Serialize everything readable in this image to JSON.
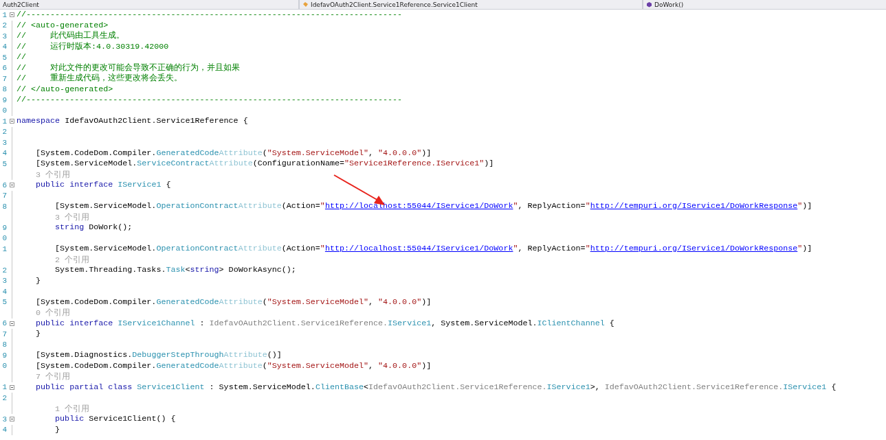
{
  "navigation_bar": [
    {
      "label": "Auth2Client"
    },
    {
      "label": "IdefavOAuth2Client.Service1Reference.Service1Client"
    },
    {
      "label": "DoWork()"
    }
  ],
  "editor": {
    "rows": [
      {
        "kind": "code",
        "gutter": "1",
        "collapsible": true,
        "tokens": [
          {
            "kind": "comment",
            "text": "//------------------------------------------------------------------------------"
          }
        ]
      },
      {
        "kind": "code",
        "gutter": "2",
        "collapsible": false,
        "tokens": [
          {
            "kind": "comment",
            "text": "// <auto-generated>"
          }
        ]
      },
      {
        "kind": "code",
        "gutter": "3",
        "collapsible": false,
        "tokens": [
          {
            "kind": "comment",
            "text": "//     此代码由工具生成。"
          }
        ]
      },
      {
        "kind": "code",
        "gutter": "4",
        "collapsible": false,
        "tokens": [
          {
            "kind": "comment",
            "text": "//     运行时版本:4.0.30319.42000"
          }
        ]
      },
      {
        "kind": "code",
        "gutter": "5",
        "collapsible": false,
        "tokens": [
          {
            "kind": "comment",
            "text": "//"
          }
        ]
      },
      {
        "kind": "code",
        "gutter": "6",
        "collapsible": false,
        "tokens": [
          {
            "kind": "comment",
            "text": "//     对此文件的更改可能会导致不正确的行为，并且如果"
          }
        ]
      },
      {
        "kind": "code",
        "gutter": "7",
        "collapsible": false,
        "tokens": [
          {
            "kind": "comment",
            "text": "//     重新生成代码，这些更改将会丢失。"
          }
        ]
      },
      {
        "kind": "code",
        "gutter": "8",
        "collapsible": false,
        "tokens": [
          {
            "kind": "comment",
            "text": "// </auto-generated>"
          }
        ]
      },
      {
        "kind": "code",
        "gutter": "9",
        "collapsible": false,
        "tokens": [
          {
            "kind": "comment",
            "text": "//------------------------------------------------------------------------------"
          }
        ]
      },
      {
        "kind": "code",
        "gutter": "0",
        "collapsible": false,
        "tokens": []
      },
      {
        "kind": "code",
        "gutter": "1",
        "collapsible": true,
        "tokens": [
          {
            "kind": "keyword",
            "text": "namespace"
          },
          {
            "kind": "plain",
            "text": " IdefavOAuth2Client.Service1Reference {"
          }
        ]
      },
      {
        "kind": "code",
        "gutter": "2",
        "collapsible": false,
        "tokens": []
      },
      {
        "kind": "code",
        "gutter": "3",
        "collapsible": false,
        "tokens": []
      },
      {
        "kind": "code",
        "gutter": "4",
        "collapsible": false,
        "tokens": [
          {
            "kind": "plain",
            "text": "    [System.CodeDom.Compiler."
          },
          {
            "kind": "type",
            "text": "GeneratedCode"
          },
          {
            "kind": "faded",
            "text": "Attribute"
          },
          {
            "kind": "plain",
            "text": "("
          },
          {
            "kind": "string",
            "text": "\"System.ServiceModel\""
          },
          {
            "kind": "plain",
            "text": ", "
          },
          {
            "kind": "string",
            "text": "\"4.0.0.0\""
          },
          {
            "kind": "plain",
            "text": ")]"
          }
        ]
      },
      {
        "kind": "code",
        "gutter": "5",
        "collapsible": false,
        "tokens": [
          {
            "kind": "plain",
            "text": "    [System.ServiceModel."
          },
          {
            "kind": "type",
            "text": "ServiceContract"
          },
          {
            "kind": "faded",
            "text": "Attribute"
          },
          {
            "kind": "plain",
            "text": "(ConfigurationName="
          },
          {
            "kind": "string",
            "text": "\"Service1Reference.IService1\""
          },
          {
            "kind": "plain",
            "text": ")]"
          }
        ]
      },
      {
        "kind": "lens",
        "text": "    3 个引用"
      },
      {
        "kind": "code",
        "gutter": "6",
        "collapsible": true,
        "tokens": [
          {
            "kind": "keyword",
            "text": "    public"
          },
          {
            "kind": "keyword",
            "text": " interface"
          },
          {
            "kind": "type",
            "text": " IService1"
          },
          {
            "kind": "plain",
            "text": " {"
          }
        ]
      },
      {
        "kind": "code",
        "gutter": "7",
        "collapsible": false,
        "tokens": []
      },
      {
        "kind": "code",
        "gutter": "8",
        "collapsible": false,
        "tokens": [
          {
            "kind": "plain",
            "text": "        [System.ServiceModel."
          },
          {
            "kind": "type",
            "text": "OperationContract"
          },
          {
            "kind": "faded",
            "text": "Attribute"
          },
          {
            "kind": "plain",
            "text": "(Action="
          },
          {
            "kind": "string",
            "text": "\""
          },
          {
            "kind": "link",
            "text": "http://localhost:55044/IService1/DoWork"
          },
          {
            "kind": "string",
            "text": "\""
          },
          {
            "kind": "plain",
            "text": ", ReplyAction="
          },
          {
            "kind": "string",
            "text": "\""
          },
          {
            "kind": "link",
            "text": "http://tempuri.org/IService1/DoWorkResponse"
          },
          {
            "kind": "string",
            "text": "\""
          },
          {
            "kind": "plain",
            "text": ")]"
          }
        ]
      },
      {
        "kind": "lens",
        "text": "        3 个引用"
      },
      {
        "kind": "code",
        "gutter": "9",
        "collapsible": false,
        "tokens": [
          {
            "kind": "keyword",
            "text": "        string"
          },
          {
            "kind": "plain",
            "text": " DoWork();"
          }
        ]
      },
      {
        "kind": "code",
        "gutter": "0",
        "collapsible": false,
        "tokens": []
      },
      {
        "kind": "code",
        "gutter": "1",
        "collapsible": false,
        "tokens": [
          {
            "kind": "plain",
            "text": "        [System.ServiceModel."
          },
          {
            "kind": "type",
            "text": "OperationContract"
          },
          {
            "kind": "faded",
            "text": "Attribute"
          },
          {
            "kind": "plain",
            "text": "(Action="
          },
          {
            "kind": "string",
            "text": "\""
          },
          {
            "kind": "link",
            "text": "http://localhost:55044/IService1/DoWork"
          },
          {
            "kind": "string",
            "text": "\""
          },
          {
            "kind": "plain",
            "text": ", ReplyAction="
          },
          {
            "kind": "string",
            "text": "\""
          },
          {
            "kind": "link",
            "text": "http://tempuri.org/IService1/DoWorkResponse"
          },
          {
            "kind": "string",
            "text": "\""
          },
          {
            "kind": "plain",
            "text": ")]"
          }
        ]
      },
      {
        "kind": "lens",
        "text": "        2 个引用"
      },
      {
        "kind": "code",
        "gutter": "2",
        "collapsible": false,
        "tokens": [
          {
            "kind": "plain",
            "text": "        System.Threading.Tasks."
          },
          {
            "kind": "type",
            "text": "Task"
          },
          {
            "kind": "plain",
            "text": "<"
          },
          {
            "kind": "keyword",
            "text": "string"
          },
          {
            "kind": "plain",
            "text": "> DoWorkAsync();"
          }
        ]
      },
      {
        "kind": "code",
        "gutter": "3",
        "collapsible": false,
        "tokens": [
          {
            "kind": "plain",
            "text": "    }"
          }
        ]
      },
      {
        "kind": "code",
        "gutter": "4",
        "collapsible": false,
        "tokens": []
      },
      {
        "kind": "code",
        "gutter": "5",
        "collapsible": false,
        "tokens": [
          {
            "kind": "plain",
            "text": "    [System.CodeDom.Compiler."
          },
          {
            "kind": "type",
            "text": "GeneratedCode"
          },
          {
            "kind": "faded",
            "text": "Attribute"
          },
          {
            "kind": "plain",
            "text": "("
          },
          {
            "kind": "string",
            "text": "\"System.ServiceModel\""
          },
          {
            "kind": "plain",
            "text": ", "
          },
          {
            "kind": "string",
            "text": "\"4.0.0.0\""
          },
          {
            "kind": "plain",
            "text": ")]"
          }
        ]
      },
      {
        "kind": "lens",
        "text": "    0 个引用"
      },
      {
        "kind": "code",
        "gutter": "6",
        "collapsible": true,
        "tokens": [
          {
            "kind": "keyword",
            "text": "    public"
          },
          {
            "kind": "keyword",
            "text": " interface"
          },
          {
            "kind": "type",
            "text": " IService1Channel"
          },
          {
            "kind": "plain",
            "text": " : "
          },
          {
            "kind": "gray",
            "text": "IdefavOAuth2Client.Service1Reference."
          },
          {
            "kind": "type",
            "text": "IService1"
          },
          {
            "kind": "plain",
            "text": ", System.ServiceModel."
          },
          {
            "kind": "type",
            "text": "IClientChannel"
          },
          {
            "kind": "plain",
            "text": " {"
          }
        ]
      },
      {
        "kind": "code",
        "gutter": "7",
        "collapsible": false,
        "tokens": [
          {
            "kind": "plain",
            "text": "    }"
          }
        ]
      },
      {
        "kind": "code",
        "gutter": "8",
        "collapsible": false,
        "tokens": []
      },
      {
        "kind": "code",
        "gutter": "9",
        "collapsible": false,
        "tokens": [
          {
            "kind": "plain",
            "text": "    [System.Diagnostics."
          },
          {
            "kind": "type",
            "text": "DebuggerStepThrough"
          },
          {
            "kind": "faded",
            "text": "Attribute"
          },
          {
            "kind": "plain",
            "text": "()]"
          }
        ]
      },
      {
        "kind": "code",
        "gutter": "0",
        "collapsible": false,
        "tokens": [
          {
            "kind": "plain",
            "text": "    [System.CodeDom.Compiler."
          },
          {
            "kind": "type",
            "text": "GeneratedCode"
          },
          {
            "kind": "faded",
            "text": "Attribute"
          },
          {
            "kind": "plain",
            "text": "("
          },
          {
            "kind": "string",
            "text": "\"System.ServiceModel\""
          },
          {
            "kind": "plain",
            "text": ", "
          },
          {
            "kind": "string",
            "text": "\"4.0.0.0\""
          },
          {
            "kind": "plain",
            "text": ")]"
          }
        ]
      },
      {
        "kind": "lens",
        "text": "    7 个引用"
      },
      {
        "kind": "code",
        "gutter": "1",
        "collapsible": true,
        "tokens": [
          {
            "kind": "keyword",
            "text": "    public"
          },
          {
            "kind": "keyword",
            "text": " partial"
          },
          {
            "kind": "keyword",
            "text": " class"
          },
          {
            "kind": "type",
            "text": " Service1Client"
          },
          {
            "kind": "plain",
            "text": " : System.ServiceModel."
          },
          {
            "kind": "type",
            "text": "ClientBase"
          },
          {
            "kind": "plain",
            "text": "<"
          },
          {
            "kind": "gray",
            "text": "IdefavOAuth2Client.Service1Reference."
          },
          {
            "kind": "type",
            "text": "IService1"
          },
          {
            "kind": "plain",
            "text": ">, "
          },
          {
            "kind": "gray",
            "text": "IdefavOAuth2Client.Service1Reference."
          },
          {
            "kind": "type",
            "text": "IService1"
          },
          {
            "kind": "plain",
            "text": " {"
          }
        ]
      },
      {
        "kind": "code",
        "gutter": "2",
        "collapsible": false,
        "tokens": []
      },
      {
        "kind": "lens",
        "text": "        1 个引用"
      },
      {
        "kind": "code",
        "gutter": "3",
        "collapsible": true,
        "tokens": [
          {
            "kind": "keyword",
            "text": "        public"
          },
          {
            "kind": "plain",
            "text": " Service1Client() {"
          }
        ]
      },
      {
        "kind": "code",
        "gutter": "4",
        "collapsible": false,
        "tokens": [
          {
            "kind": "plain",
            "text": "        }"
          }
        ]
      }
    ]
  }
}
